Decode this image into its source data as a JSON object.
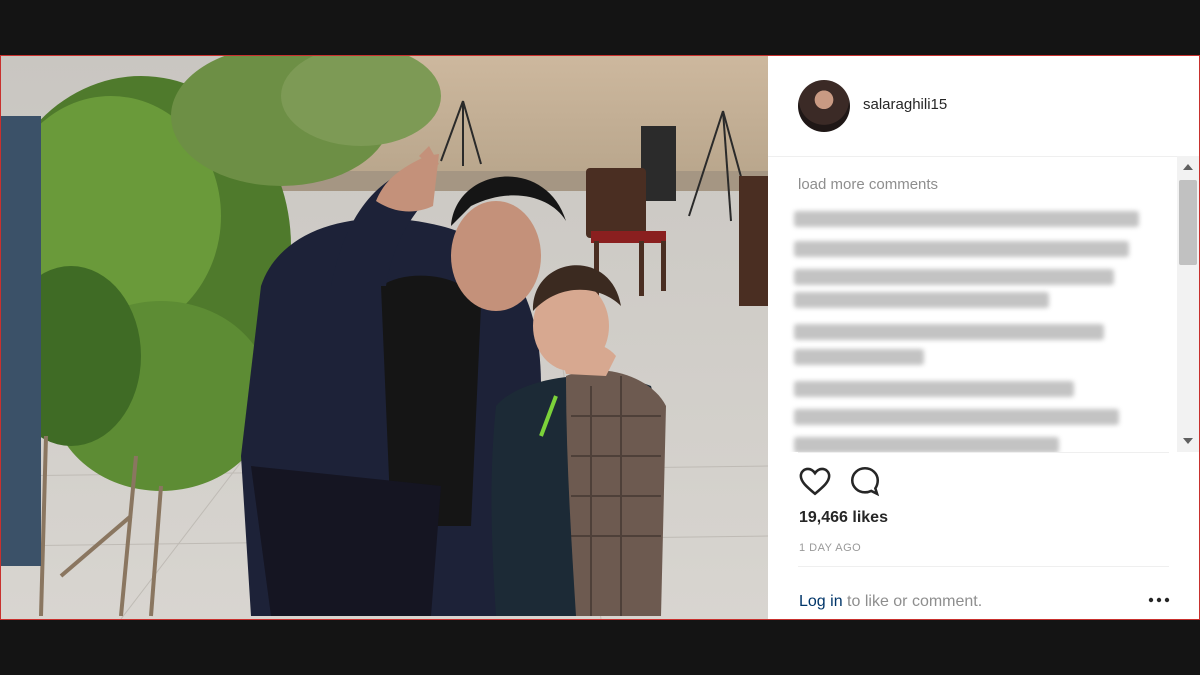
{
  "post": {
    "username": "salaraghili15",
    "load_more": "load more comments",
    "likes": "19,466 likes",
    "age": "1 DAY AGO",
    "login_link": "Log in",
    "login_rest": " to like or comment."
  },
  "icons": {
    "like": "heart-icon",
    "comment": "comment-bubble-icon",
    "more": "more-options-icon"
  },
  "colors": {
    "frame_border": "#c8312e",
    "link": "#003569",
    "muted": "#8e8e8e"
  }
}
